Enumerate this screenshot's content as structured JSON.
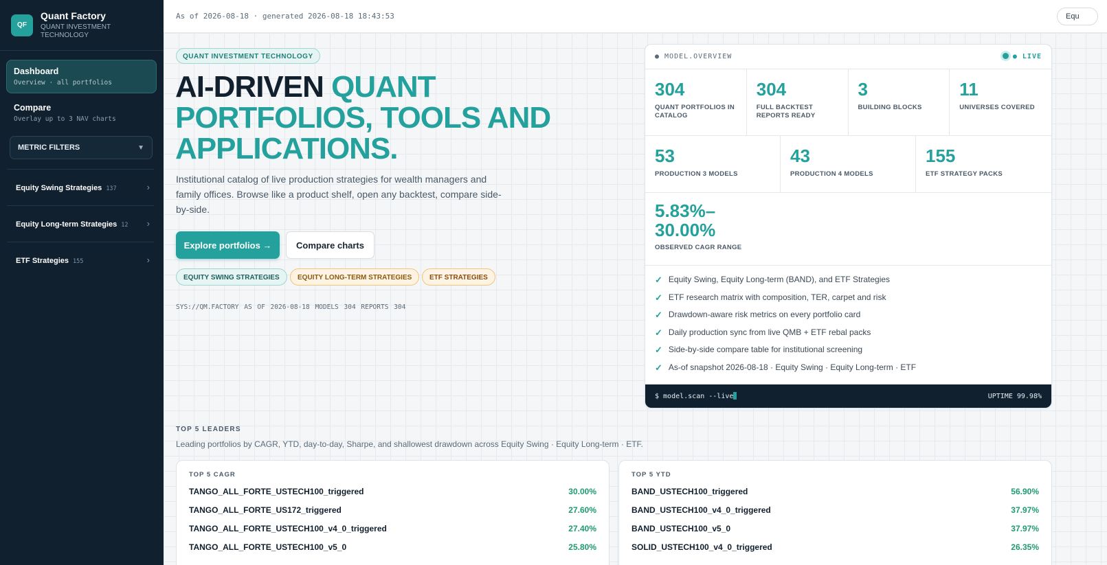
{
  "brand": {
    "logo": "QF",
    "name": "Quant Factory",
    "subtitle": "QUANT INVESTMENT TECHNOLOGY"
  },
  "nav": {
    "dashboard": {
      "label": "Dashboard",
      "sub": "Overview · all portfolios"
    },
    "compare": {
      "label": "Compare",
      "sub": "Overlay up to 3 NAV charts"
    },
    "filters": "METRIC FILTERS",
    "categories": [
      {
        "label": "Equity Swing Strategies",
        "count": "137"
      },
      {
        "label": "Equity Long-term Strategies",
        "count": "12"
      },
      {
        "label": "ETF Strategies",
        "count": "155"
      }
    ]
  },
  "topbar": {
    "asof": "As of 2026-08-18 · generated 2026-08-18 18:43:53",
    "pill": "Equ"
  },
  "hero": {
    "eyebrow": "QUANT INVESTMENT TECHNOLOGY",
    "title_dark": "AI-DRIVEN ",
    "title_accent": "QUANT PORTFOLIOS, TOOLS AND APPLICATIONS.",
    "lead": "Institutional catalog of live production strategies for wealth managers and family offices. Browse like a product shelf, open any backtest, compare side-by-side.",
    "primary": "Explore portfolios →",
    "secondary": "Compare charts",
    "tags": [
      "EQUITY SWING STRATEGIES",
      "EQUITY LONG-TERM STRATEGIES",
      "ETF STRATEGIES"
    ],
    "sys": "SYS://QM.FACTORY  AS OF 2026-08-18  MODELS 304  REPORTS 304"
  },
  "model": {
    "title": "● MODEL.OVERVIEW",
    "live": "● LIVE",
    "row1": [
      {
        "value": "304",
        "label": "QUANT PORTFOLIOS IN CATALOG"
      },
      {
        "value": "304",
        "label": "FULL BACKTEST REPORTS READY"
      },
      {
        "value": "3",
        "label": "BUILDING BLOCKS"
      },
      {
        "value": "11",
        "label": "UNIVERSES COVERED"
      }
    ],
    "row2": [
      {
        "value": "53",
        "label": "PRODUCTION 3 MODELS"
      },
      {
        "value": "43",
        "label": "PRODUCTION 4 MODELS"
      },
      {
        "value": "155",
        "label": "ETF STRATEGY PACKS"
      }
    ],
    "cagr": {
      "line1": "5.83%–",
      "line2": "30.00%",
      "label": "OBSERVED CAGR RANGE"
    },
    "checks": [
      "Equity Swing, Equity Long-term (BAND), and ETF Strategies",
      "ETF research matrix with composition, TER, carpet and risk",
      "Drawdown-aware risk metrics on every portfolio card",
      "Daily production sync from live QMB + ETF rebal packs",
      "Side-by-side compare table for institutional screening",
      "As-of snapshot 2026-08-18 · Equity Swing · Equity Long-term · ETF"
    ],
    "terminal": "$ model.scan --live",
    "uptime": "UPTIME 99.98%"
  },
  "leaders": {
    "title": "TOP 5 LEADERS",
    "sub": "Leading portfolios by CAGR, YTD, day-to-day, Sharpe, and shallowest drawdown across Equity Swing · Equity Long-term · ETF.",
    "boards": [
      {
        "title": "TOP 5 CAGR",
        "rows": [
          {
            "name": "TANGO_ALL_FORTE_USTECH100_triggered",
            "value": "30.00%"
          },
          {
            "name": "TANGO_ALL_FORTE_US172_triggered",
            "value": "27.60%"
          },
          {
            "name": "TANGO_ALL_FORTE_USTECH100_v4_0_triggered",
            "value": "27.40%"
          },
          {
            "name": "TANGO_ALL_FORTE_USTECH100_v5_0",
            "value": "25.80%"
          }
        ]
      },
      {
        "title": "TOP 5 YTD",
        "rows": [
          {
            "name": "BAND_USTECH100_triggered",
            "value": "56.90%"
          },
          {
            "name": "BAND_USTECH100_v4_0_triggered",
            "value": "37.97%"
          },
          {
            "name": "BAND_USTECH100_v5_0",
            "value": "37.97%"
          },
          {
            "name": "SOLID_USTECH100_v4_0_triggered",
            "value": "26.35%"
          }
        ]
      }
    ]
  }
}
